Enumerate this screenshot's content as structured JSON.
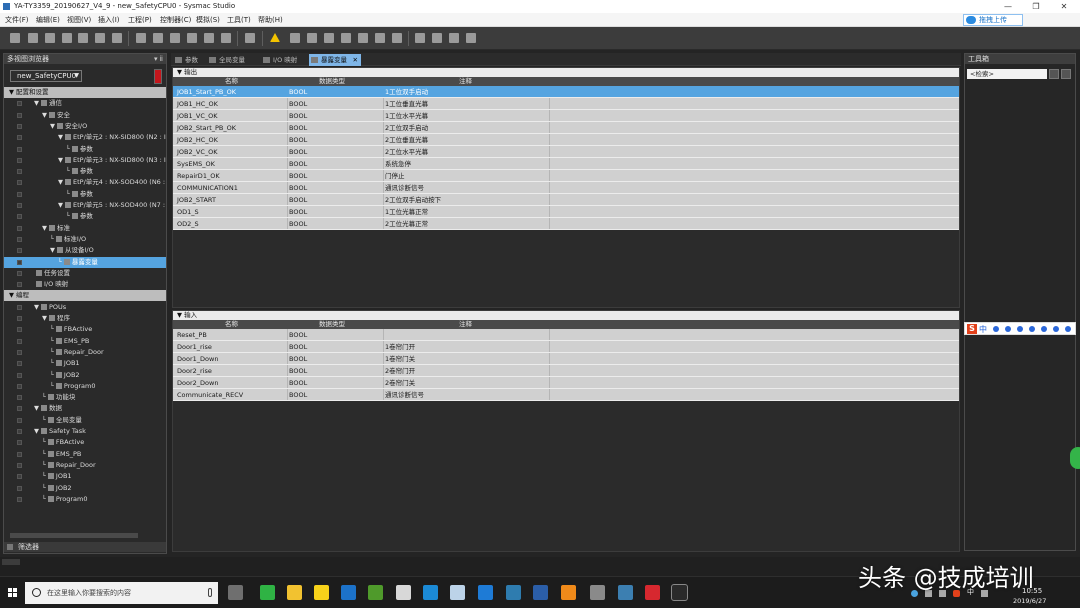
{
  "window": {
    "title": "YA-TY3359_20190627_V4_9 - new_SafetyCPU0 - Sysmac Studio",
    "controls": [
      "—",
      "❐",
      "✕"
    ],
    "share_button": "拖拽上传"
  },
  "menu": [
    "文件(F)",
    "编辑(E)",
    "视图(V)",
    "插入(I)",
    "工程(P)",
    "控制器(C)",
    "模拟(S)",
    "工具(T)",
    "帮助(H)"
  ],
  "left_panel": {
    "title": "多视图浏览器",
    "pin": "▾ ⅱ",
    "device_select": "new_SafetyCPU0",
    "tree": [
      {
        "label": "配置和设置",
        "indent": 0,
        "type": "group",
        "arrow": "▼"
      },
      {
        "label": "通信",
        "indent": 1,
        "arrow": "▼"
      },
      {
        "label": "安全",
        "indent": 2,
        "arrow": "▼"
      },
      {
        "label": "安全I/O",
        "indent": 3,
        "arrow": "▼"
      },
      {
        "label": "EtP/单元2 : NX-SID800 (N2 : In",
        "indent": 4,
        "arrow": "▼"
      },
      {
        "label": "参数",
        "indent": 5,
        "arrow": "└"
      },
      {
        "label": "EtP/单元3 : NX-SID800 (N3 : In",
        "indent": 4,
        "arrow": "▼"
      },
      {
        "label": "参数",
        "indent": 5,
        "arrow": "└"
      },
      {
        "label": "EtP/单元4 : NX-SOD400 (N6 : Ir",
        "indent": 4,
        "arrow": "▼"
      },
      {
        "label": "参数",
        "indent": 5,
        "arrow": "└"
      },
      {
        "label": "EtP/单元5 : NX-SOD400 (N7 : I",
        "indent": 4,
        "arrow": "▼"
      },
      {
        "label": "参数",
        "indent": 5,
        "arrow": "└"
      },
      {
        "label": "标准",
        "indent": 2,
        "arrow": "▼"
      },
      {
        "label": "标准I/O",
        "indent": 3,
        "arrow": "└"
      },
      {
        "label": "从设备I/O",
        "indent": 3,
        "arrow": "▼"
      },
      {
        "label": "暴露变量",
        "indent": 4,
        "arrow": "└",
        "selected": true
      },
      {
        "label": "任务设置",
        "indent": 1,
        "arrow": ""
      },
      {
        "label": "I/O 映射",
        "indent": 1,
        "arrow": ""
      },
      {
        "label": "编程",
        "indent": 0,
        "type": "group",
        "arrow": "▼"
      },
      {
        "label": "POUs",
        "indent": 1,
        "arrow": "▼"
      },
      {
        "label": "程序",
        "indent": 2,
        "arrow": "▼"
      },
      {
        "label": "FBActive",
        "indent": 3,
        "arrow": "└"
      },
      {
        "label": "EMS_PB",
        "indent": 3,
        "arrow": "└"
      },
      {
        "label": "Repair_Door",
        "indent": 3,
        "arrow": "└"
      },
      {
        "label": "JOB1",
        "indent": 3,
        "arrow": "└"
      },
      {
        "label": "JOB2",
        "indent": 3,
        "arrow": "└"
      },
      {
        "label": "Program0",
        "indent": 3,
        "arrow": "└"
      },
      {
        "label": "功能块",
        "indent": 2,
        "arrow": "└"
      },
      {
        "label": "数据",
        "indent": 1,
        "arrow": "▼"
      },
      {
        "label": "全局变量",
        "indent": 2,
        "arrow": "└"
      },
      {
        "label": "Safety Task",
        "indent": 1,
        "arrow": "▼"
      },
      {
        "label": "FBActive",
        "indent": 2,
        "arrow": "└"
      },
      {
        "label": "EMS_PB",
        "indent": 2,
        "arrow": "└"
      },
      {
        "label": "Repair_Door",
        "indent": 2,
        "arrow": "└"
      },
      {
        "label": "JOB1",
        "indent": 2,
        "arrow": "└"
      },
      {
        "label": "JOB2",
        "indent": 2,
        "arrow": "└"
      },
      {
        "label": "Program0",
        "indent": 2,
        "arrow": "└"
      }
    ],
    "footer": "筛选器"
  },
  "tabs": [
    {
      "label": "参数",
      "active": false
    },
    {
      "label": "全局变量",
      "active": false
    },
    {
      "label": "I/O 映射",
      "active": false
    },
    {
      "label": "暴露变量",
      "active": true,
      "close": "✕"
    }
  ],
  "outputs": {
    "title": "▼ 输出",
    "columns": [
      "名称",
      "数据类型",
      "注释"
    ],
    "rows": [
      {
        "name": "JOB1_Start_PB_OK",
        "type": "BOOL",
        "comment": "1工位双手启动"
      },
      {
        "name": "JOB1_HC_OK",
        "type": "BOOL",
        "comment": "1工位垂直光幕"
      },
      {
        "name": "JOB1_VC_OK",
        "type": "BOOL",
        "comment": "1工位水平光幕"
      },
      {
        "name": "JOB2_Start_PB_OK",
        "type": "BOOL",
        "comment": "2工位双手启动"
      },
      {
        "name": "JOB2_HC_OK",
        "type": "BOOL",
        "comment": "2工位垂直光幕"
      },
      {
        "name": "JOB2_VC_OK",
        "type": "BOOL",
        "comment": "2工位水平光幕"
      },
      {
        "name": "SysEMS_OK",
        "type": "BOOL",
        "comment": "系统急停"
      },
      {
        "name": "RepairD1_OK",
        "type": "BOOL",
        "comment": "门停止"
      },
      {
        "name": "COMMUNICATION1",
        "type": "BOOL",
        "comment": "通讯诊断信号"
      },
      {
        "name": "JOB2_START",
        "type": "BOOL",
        "comment": "2工位双手启动按下"
      },
      {
        "name": "OD1_S",
        "type": "BOOL",
        "comment": "1工位光幕正常"
      },
      {
        "name": "OD2_S",
        "type": "BOOL",
        "comment": "2工位光幕正常"
      }
    ]
  },
  "inputs": {
    "title": "▼ 输入",
    "columns": [
      "名称",
      "数据类型",
      "注释"
    ],
    "rows": [
      {
        "name": "Reset_PB",
        "type": "BOOL",
        "comment": ""
      },
      {
        "name": "Door1_rise",
        "type": "BOOL",
        "comment": "1卷帘门开"
      },
      {
        "name": "Door1_Down",
        "type": "BOOL",
        "comment": "1卷帘门关"
      },
      {
        "name": "Door2_rise",
        "type": "BOOL",
        "comment": "2卷帘门开"
      },
      {
        "name": "Door2_Down",
        "type": "BOOL",
        "comment": "2卷帘门关"
      },
      {
        "name": "Communicate_RECV",
        "type": "BOOL",
        "comment": "通讯诊断信号"
      }
    ]
  },
  "right_panel": {
    "title": "工具箱",
    "search": "<检索>"
  },
  "ime": {
    "logo": "S",
    "lang": "中"
  },
  "taskbar": {
    "search_placeholder": "在这里输入你要搜索的内容",
    "apps": [
      {
        "name": "task-view",
        "color": "#6f6f6f"
      },
      {
        "name": "wechat",
        "color": "#2fb344"
      },
      {
        "name": "file-explorer",
        "color": "#f2c230"
      },
      {
        "name": "sticky-notes",
        "color": "#f7d21a"
      },
      {
        "name": "outlook",
        "color": "#1c72c9"
      },
      {
        "name": "green-app",
        "color": "#4f9a2b"
      },
      {
        "name": "red-app",
        "color": "#d8d8d8"
      },
      {
        "name": "blue-app",
        "color": "#1b8ad6"
      },
      {
        "name": "gray-app",
        "color": "#bcd3e8"
      },
      {
        "name": "edge",
        "color": "#1e7bd6"
      },
      {
        "name": "tia-portal",
        "color": "#2e7caf"
      },
      {
        "name": "word",
        "color": "#2b5ea8"
      },
      {
        "name": "orange-app",
        "color": "#f08a1a"
      },
      {
        "name": "gray-app-2",
        "color": "#8a8a8a"
      },
      {
        "name": "app-2",
        "color": "#3c7fb1"
      },
      {
        "name": "pdf-app",
        "color": "#d7282f"
      },
      {
        "name": "sysmac-studio",
        "color": "#2a2a2a"
      }
    ],
    "tray_lang": "中",
    "time": "10:55",
    "date": "2019/6/27"
  },
  "overlay_text": "头条 @技成培训"
}
